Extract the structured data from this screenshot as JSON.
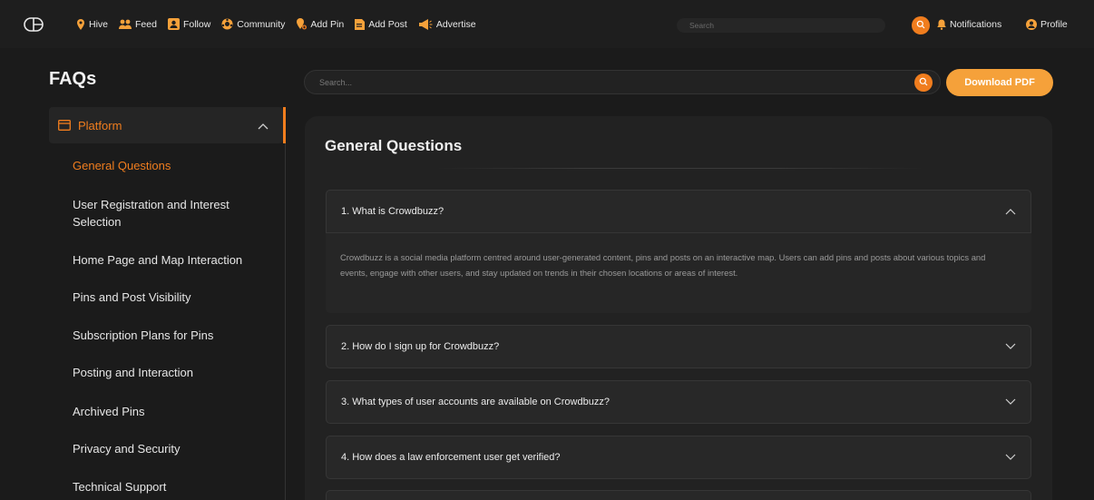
{
  "nav": {
    "items": [
      {
        "label": "Hive",
        "icon": "pin-icon"
      },
      {
        "label": "Feed",
        "icon": "users-icon"
      },
      {
        "label": "Follow",
        "icon": "follow-icon"
      },
      {
        "label": "Community",
        "icon": "community-icon"
      },
      {
        "label": "Add Pin",
        "icon": "add-pin-icon"
      },
      {
        "label": "Add Post",
        "icon": "add-post-icon"
      },
      {
        "label": "Advertise",
        "icon": "megaphone-icon"
      }
    ],
    "search_placeholder": "Search",
    "notifications": "Notifications",
    "profile": "Profile",
    "accent": "#f07d1e"
  },
  "sidebar": {
    "title": "FAQs",
    "category": "Platform",
    "items": [
      "General Questions",
      "User Registration and Interest Selection",
      "Home Page and Map Interaction",
      "Pins and Post Visibility",
      "Subscription Plans for Pins",
      "Posting and Interaction",
      "Archived Pins",
      "Privacy and Security",
      "Technical Support"
    ]
  },
  "main": {
    "search_placeholder": "Search...",
    "download_label": "Download PDF",
    "section_title": "General Questions",
    "questions": [
      "1. What is Crowdbuzz?",
      "2. How do I sign up for Crowdbuzz?",
      "3. What types of user accounts are available on Crowdbuzz?",
      "4. How does a law enforcement user get verified?"
    ],
    "answer_1": "Crowdbuzz is a social media platform centred around user-generated content, pins and posts on an interactive map. Users can add pins and posts about various topics and events, engage with other users, and stay updated on trends in their chosen locations or areas of interest."
  }
}
